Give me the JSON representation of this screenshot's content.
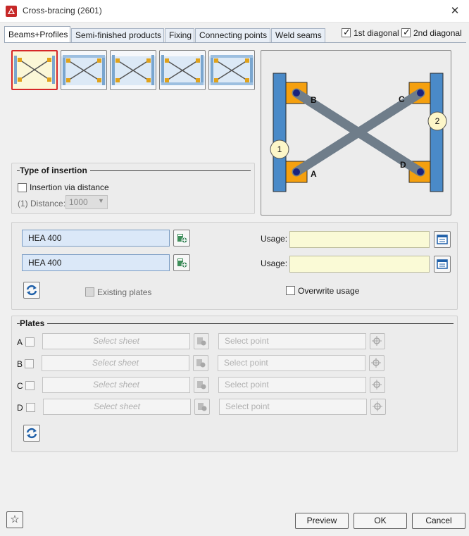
{
  "window": {
    "title": "Cross-bracing (2601)",
    "close_glyph": "✕"
  },
  "tabs": [
    {
      "label": "Beams+Profiles",
      "active": true
    },
    {
      "label": "Semi-finished products"
    },
    {
      "label": "Fixing"
    },
    {
      "label": "Connecting points"
    },
    {
      "label": "Weld seams"
    }
  ],
  "diagonals": {
    "first_label": "1st diagonal",
    "first_checked": true,
    "second_label": "2nd diagonal",
    "second_checked": true
  },
  "variants": {
    "selected_index": 0,
    "count": 5
  },
  "preview": {
    "point_labels": [
      "B",
      "C",
      "A",
      "D"
    ],
    "beam_labels": [
      "1",
      "2"
    ],
    "colors": {
      "beam": "#4a8ac8",
      "plate": "#f5a00f",
      "brace": "#6f7d8a",
      "dot": "#1a237e",
      "badge": "#fdf6c8"
    }
  },
  "insertion": {
    "title": "Type of insertion",
    "via_distance_label": "Insertion via distance",
    "via_distance_checked": false,
    "distance_label": "(1) Distance:",
    "distance_value": "1000"
  },
  "profiles": {
    "profile1": "HEA 400",
    "profile2": "HEA 400",
    "usage_label": "Usage:",
    "existing_plates_label": "Existing plates",
    "overwrite_usage_label": "Overwrite usage"
  },
  "plates": {
    "title": "Plates",
    "rows": [
      {
        "id": "A",
        "sheet_placeholder": "Select sheet",
        "point_placeholder": "Select point"
      },
      {
        "id": "B",
        "sheet_placeholder": "Select sheet",
        "point_placeholder": "Select point"
      },
      {
        "id": "C",
        "sheet_placeholder": "Select sheet",
        "point_placeholder": "Select point"
      },
      {
        "id": "D",
        "sheet_placeholder": "Select sheet",
        "point_placeholder": "Select point"
      }
    ]
  },
  "buttons": {
    "preview": "Preview",
    "ok": "OK",
    "cancel": "Cancel"
  },
  "icons": [
    "app-icon",
    "close-icon",
    "profile-catalog-icon",
    "usage-list-icon",
    "refresh-icon",
    "favorite-star-icon"
  ]
}
